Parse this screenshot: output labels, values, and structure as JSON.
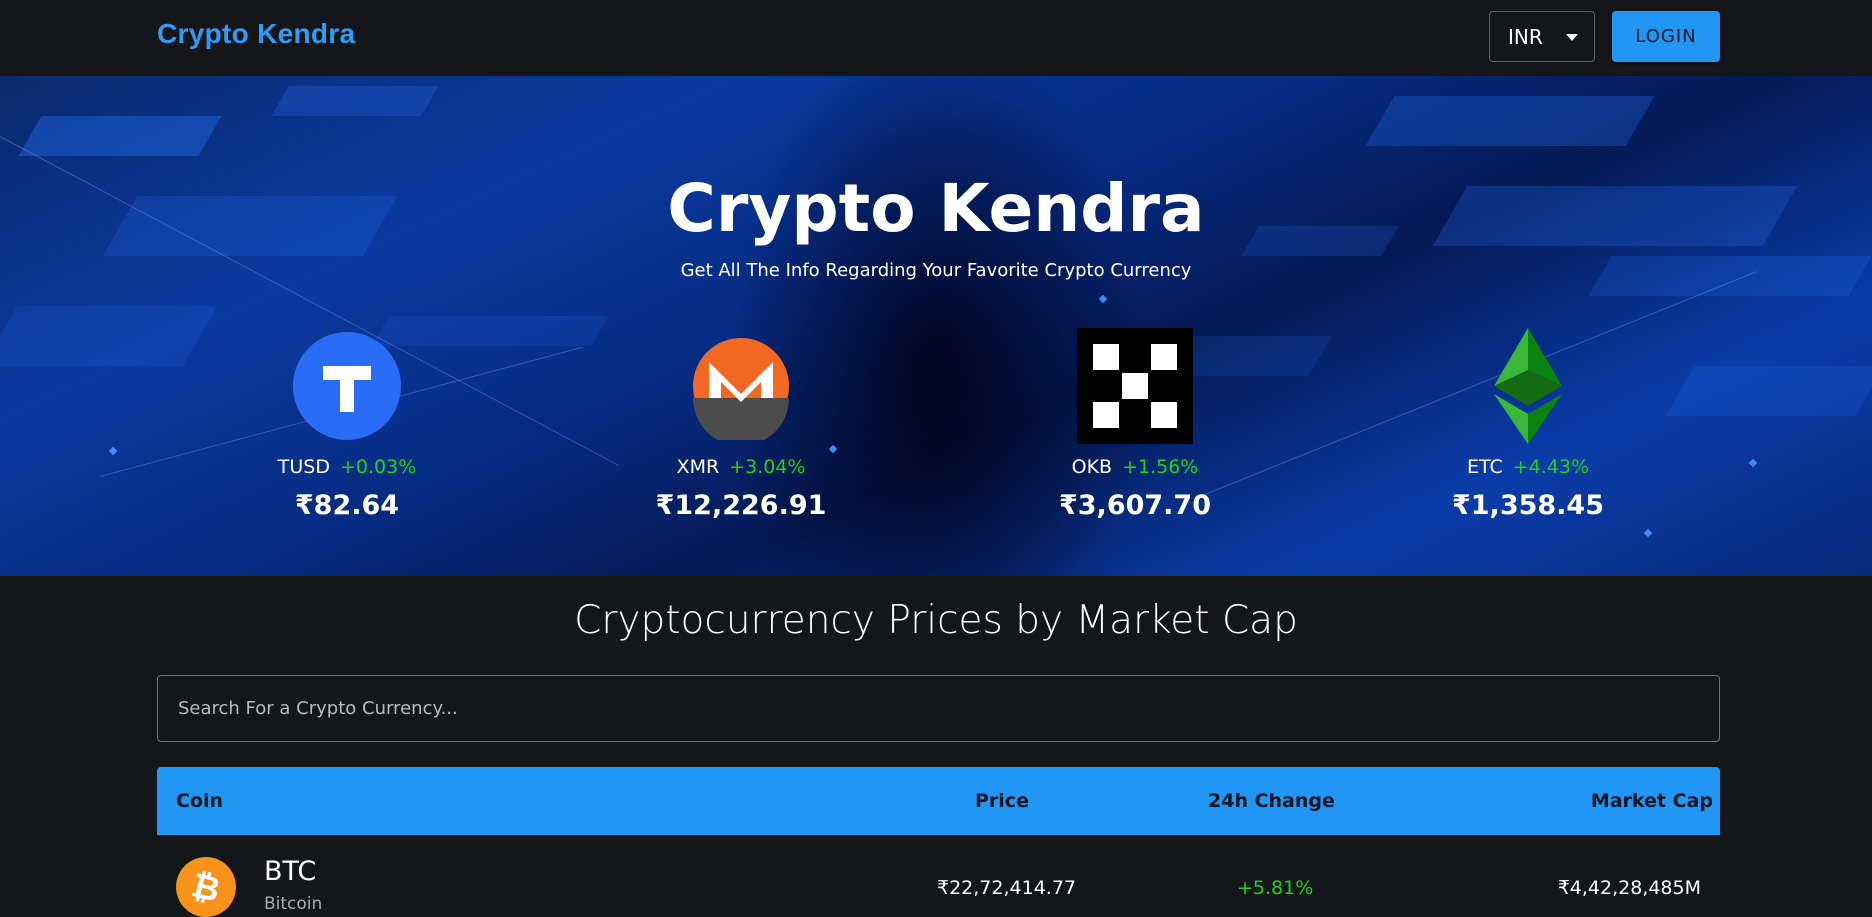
{
  "header": {
    "brand": "Crypto Kendra",
    "currency": "INR",
    "login_label": "LOGIN"
  },
  "hero": {
    "title": "Crypto Kendra",
    "subtitle": "Get All The Info Regarding Your Favorite Crypto Currency",
    "coins": [
      {
        "symbol": "TUSD",
        "change": "+0.03%",
        "price": "₹82.64",
        "icon": "tusd-icon"
      },
      {
        "symbol": "XMR",
        "change": "+3.04%",
        "price": "₹12,226.91",
        "icon": "monero-icon"
      },
      {
        "symbol": "OKB",
        "change": "+1.56%",
        "price": "₹3,607.70",
        "icon": "okb-icon"
      },
      {
        "symbol": "ETC",
        "change": "+4.43%",
        "price": "₹1,358.45",
        "icon": "ethereum-classic-icon"
      }
    ]
  },
  "main": {
    "section_title": "Cryptocurrency Prices by Market Cap",
    "search_placeholder": "Search For a Crypto Currency...",
    "table": {
      "headers": [
        "Coin",
        "Price",
        "24h Change",
        "Market Cap"
      ],
      "rows": [
        {
          "symbol": "BTC",
          "name": "Bitcoin",
          "price": "₹22,72,414.77",
          "change": "+5.81%",
          "market_cap": "₹4,42,28,485M",
          "icon": "bitcoin-icon"
        }
      ]
    }
  },
  "colors": {
    "accent": "#2196f3",
    "brand": "#2f9bf5",
    "positive": "#1cd31c",
    "background": "#14161a"
  }
}
